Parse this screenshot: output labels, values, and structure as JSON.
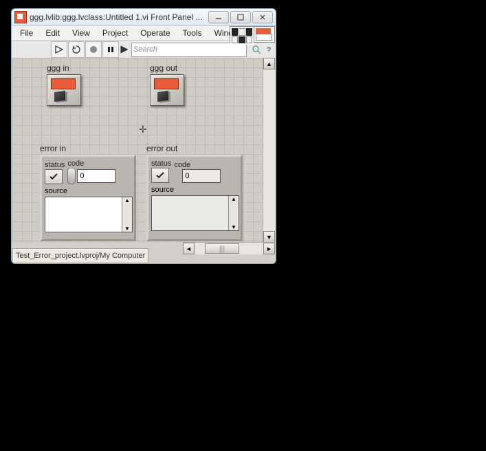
{
  "titlebar": {
    "title": "ggg.lvlib:ggg.lvclass:Untitled 1.vi Front Panel ..."
  },
  "menu": {
    "file": "File",
    "edit": "Edit",
    "view": "View",
    "project": "Project",
    "operate": "Operate",
    "tools": "Tools",
    "window": "Window"
  },
  "toolbar": {
    "search_placeholder": "Search"
  },
  "panel": {
    "ggg_in_label": "ggg in",
    "ggg_out_label": "ggg out",
    "error_in": {
      "label": "error in",
      "status_label": "status",
      "code_label": "code",
      "code_value": "0",
      "source_label": "source",
      "source_value": ""
    },
    "error_out": {
      "label": "error out",
      "status_label": "status",
      "code_label": "code",
      "code_value": "0",
      "source_label": "source",
      "source_value": ""
    }
  },
  "statusbar": {
    "text": "Test_Error_project.lvproj/My Computer"
  },
  "hscroll_thumb": "|||"
}
